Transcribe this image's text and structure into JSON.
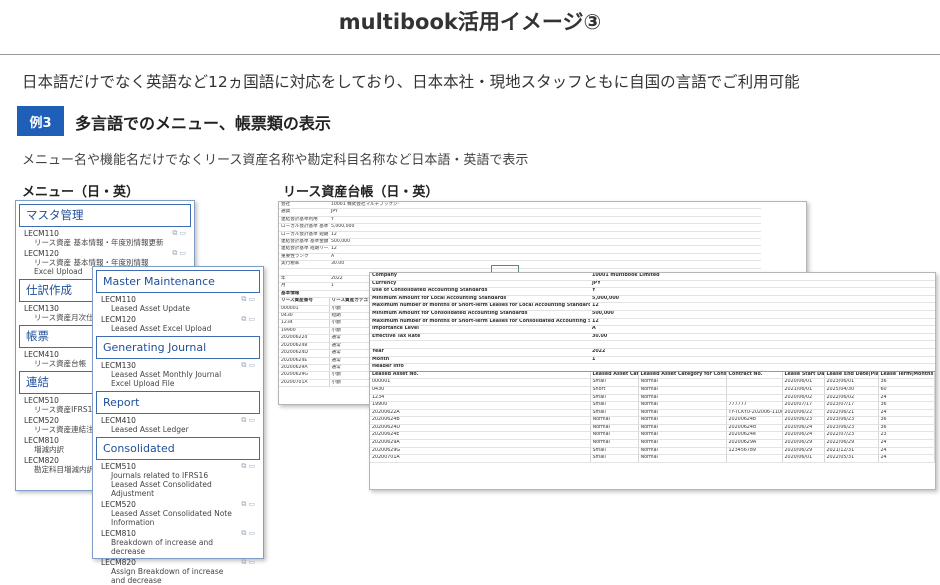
{
  "title": "multibook活用イメージ③",
  "lead": "日本語だけでなく英語など12ヵ国語に対応をしており、日本本社・現地スタッフともに自国の言語でご利用可能",
  "example": {
    "badge": "例3",
    "heading": "多言語でのメニュー、帳票類の表示",
    "description": "メニュー名や機能名だけでなくリース資産名称や勘定科目名称など日本語・英語で表示"
  },
  "captions": {
    "menu": "メニュー（日・英）",
    "ledger": "リース資産台帳（日・英）"
  },
  "menu_jp": {
    "sections": [
      {
        "title": "マスタ管理",
        "items": [
          {
            "code": "LECM110",
            "label": "リース資産 基本情報・年度別情報更新"
          },
          {
            "code": "LECM120",
            "label": "リース資産 基本情報・年度別情報Excel Upload"
          }
        ]
      },
      {
        "title": "仕訳作成",
        "items": [
          {
            "code": "LECM130",
            "label": "リース資産月次仕訳 イル作成"
          }
        ]
      },
      {
        "title": "帳票",
        "items": [
          {
            "code": "LECM410",
            "label": "リース資産台帳"
          }
        ]
      },
      {
        "title": "連結",
        "items": [
          {
            "code": "LECM510",
            "label": "リース資産IFRS1"
          },
          {
            "code": "LECM520",
            "label": "リース資産連結注"
          },
          {
            "code": "LECM810",
            "label": "増減内訳"
          },
          {
            "code": "LECM820",
            "label": "勘定科目増減内訳"
          }
        ]
      }
    ]
  },
  "menu_en": {
    "sections": [
      {
        "title": "Master Maintenance",
        "items": [
          {
            "code": "LECM110",
            "label": "Leased Asset Update"
          },
          {
            "code": "LECM120",
            "label": "Leased Asset Excel Upload"
          }
        ]
      },
      {
        "title": "Generating Journal",
        "items": [
          {
            "code": "LECM130",
            "label": "Leased Asset Monthly Journal Excel Upload File"
          }
        ]
      },
      {
        "title": "Report",
        "items": [
          {
            "code": "LECM410",
            "label": "Leased Asset Ledger"
          }
        ]
      },
      {
        "title": "Consolidated",
        "items": [
          {
            "code": "LECM510",
            "label": "Journals related to IFRS16 Leased Asset Consolidated Adjustment"
          },
          {
            "code": "LECM520",
            "label": "Leased Asset Consolidated Note Information"
          },
          {
            "code": "LECM810",
            "label": "Breakdown of increase and decrease"
          },
          {
            "code": "LECM820",
            "label": "Assign Breakdown of increase and decrease"
          }
        ]
      }
    ]
  },
  "ledger_jp": {
    "info": [
      [
        "会社",
        "10001 株式会社マルチブックジャパン"
      ],
      [
        "通貨",
        "JPY"
      ],
      [
        "連結会計基準利用",
        "Y"
      ],
      [
        "ローカル会計基準 基準",
        "5,000,000"
      ],
      [
        "ローカル会計基準 短期",
        "12"
      ],
      [
        "連結会計基準 基準金額",
        "500,000"
      ],
      [
        "連結会計基準 短期リース",
        "12"
      ],
      [
        "重要性ランク",
        "A"
      ],
      [
        "実行税率",
        "30.00"
      ],
      [
        "",
        ""
      ],
      [
        "年",
        "2022"
      ],
      [
        "月",
        "1"
      ]
    ],
    "header_label": "基本情報",
    "columns": [
      "リース資産番号",
      "リース資産カテゴリ"
    ],
    "rows": [
      [
        "000001",
        "小額"
      ],
      [
        "0430",
        "短期"
      ],
      [
        "1234",
        "小額"
      ],
      [
        "19900",
        "小額"
      ],
      [
        "202006224",
        "通常"
      ],
      [
        "202006248",
        "通常"
      ],
      [
        "20200624D",
        "通常"
      ],
      [
        "20200624E",
        "通常"
      ],
      [
        "20200629A",
        "通常"
      ],
      [
        "20200629G",
        "小額"
      ],
      [
        "20200701A",
        "小額"
      ]
    ]
  },
  "ledger_en": {
    "info": [
      [
        "Company",
        "10001 multibook Limited"
      ],
      [
        "Currency",
        "JPY"
      ],
      [
        "Use of Consolidated Accounting Standards",
        "Y"
      ],
      [
        "Minimum Amount for Local Accounting Standards",
        "5,000,000"
      ],
      [
        "Maximum number of months of Short-Term Leases for Local Accounting Standards",
        "12"
      ],
      [
        "Minimum Amount for Consolidated Accounting Standards",
        "500,000"
      ],
      [
        "Maximum number of months of Short-Term Leases for Consolidated Accounting Standards",
        "12"
      ],
      [
        "Importance Level",
        "A"
      ],
      [
        "Effective Tax Rate",
        "30.00"
      ],
      [
        "",
        ""
      ],
      [
        "Year",
        "2022"
      ],
      [
        "Month",
        "1"
      ]
    ],
    "header_label": "Header Info",
    "columns": [
      "Leased Asset No.",
      "Leased Asset Category",
      "Leased Asset Category for Consolidated",
      "Contract No.",
      "Lease Start Date",
      "Lease End Date(Planned)",
      "Lease Term(Months)"
    ],
    "rows": [
      [
        "000001",
        "Small",
        "Normal",
        "",
        "2020/06/01",
        "2023/06/01",
        "36"
      ],
      [
        "0430",
        "Short",
        "Normal",
        "",
        "2021/06/01",
        "2025/04/30",
        "60"
      ],
      [
        "1234",
        "Small",
        "Normal",
        "",
        "2020/06/02",
        "2022/06/02",
        "24"
      ],
      [
        "19900",
        "Small",
        "Normal",
        "777777",
        "2020/07/17",
        "2023/07/17",
        "36"
      ],
      [
        "20200622A",
        "Small",
        "Normal",
        "TY-TCKY0-202006-11001",
        "2020/06/22",
        "2022/06/21",
        "24"
      ],
      [
        "20200624B",
        "Normal",
        "Normal",
        "20200624b",
        "2020/06/23",
        "2023/06/23",
        "36"
      ],
      [
        "20200624D",
        "Normal",
        "Normal",
        "20200624d",
        "2020/06/24",
        "2023/06/23",
        "36"
      ],
      [
        "20200624E",
        "Normal",
        "Normal",
        "20200624e",
        "2020/06/24",
        "2022/07/23",
        "23"
      ],
      [
        "20200629A",
        "Normal",
        "Normal",
        "20200629A",
        "2020/06/29",
        "2022/06/29",
        "24"
      ],
      [
        "20200629G",
        "Small",
        "Normal",
        "123456789",
        "2020/06/29",
        "2021/12/31",
        "24"
      ],
      [
        "20200701A",
        "Small",
        "Normal",
        "",
        "2020/06/01",
        "2022/05/31",
        "24"
      ]
    ]
  },
  "icons": {
    "item_actions": [
      "copy-icon",
      "window-icon"
    ]
  }
}
